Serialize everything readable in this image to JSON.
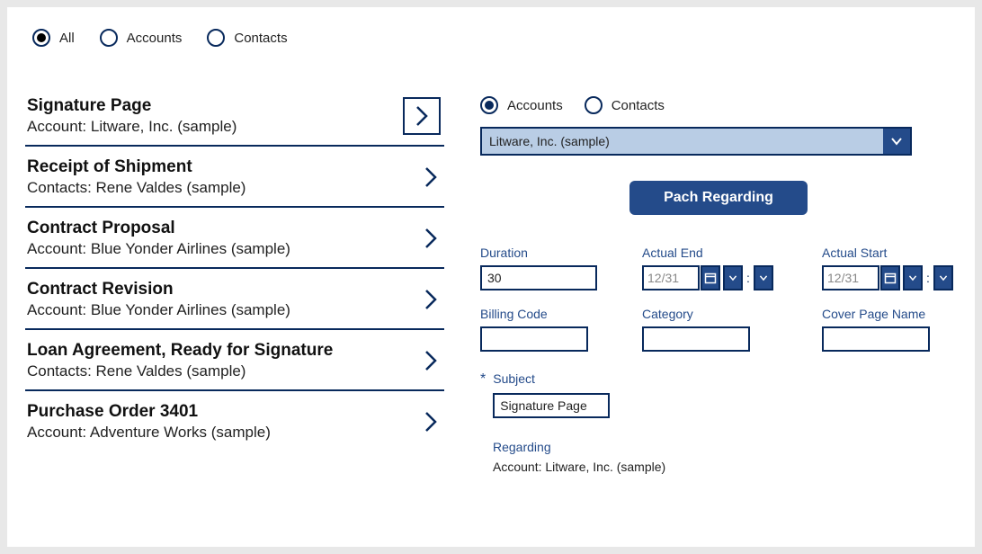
{
  "top_filters": {
    "selected": 0,
    "options": [
      "All",
      "Accounts",
      "Contacts"
    ]
  },
  "list": [
    {
      "title": "Signature Page",
      "subtitle": "Account: Litware, Inc. (sample)",
      "boxed": true
    },
    {
      "title": "Receipt of Shipment",
      "subtitle": "Contacts: Rene Valdes (sample)"
    },
    {
      "title": "Contract Proposal",
      "subtitle": "Account: Blue Yonder Airlines (sample)"
    },
    {
      "title": "Contract Revision",
      "subtitle": "Account: Blue Yonder Airlines (sample)"
    },
    {
      "title": "Loan Agreement, Ready for Signature",
      "subtitle": "Contacts: Rene Valdes (sample)"
    },
    {
      "title": "Purchase Order 3401",
      "subtitle": "Account: Adventure Works (sample)"
    }
  ],
  "right_filters": {
    "selected": 0,
    "options": [
      "Accounts",
      "Contacts"
    ]
  },
  "dropdown_value": "Litware, Inc. (sample)",
  "pach_button": "Pach Regarding",
  "form": {
    "duration": {
      "label": "Duration",
      "value": "30"
    },
    "actual_end": {
      "label": "Actual End",
      "value": "12/31"
    },
    "actual_start": {
      "label": "Actual Start",
      "value": "12/31"
    },
    "billing_code": {
      "label": "Billing Code",
      "value": ""
    },
    "category": {
      "label": "Category",
      "value": ""
    },
    "cover_page": {
      "label": "Cover Page Name",
      "value": ""
    },
    "subject": {
      "label": "Subject",
      "value": "Signature Page"
    },
    "regarding": {
      "label": "Regarding",
      "value": "Account: Litware, Inc. (sample)"
    }
  }
}
